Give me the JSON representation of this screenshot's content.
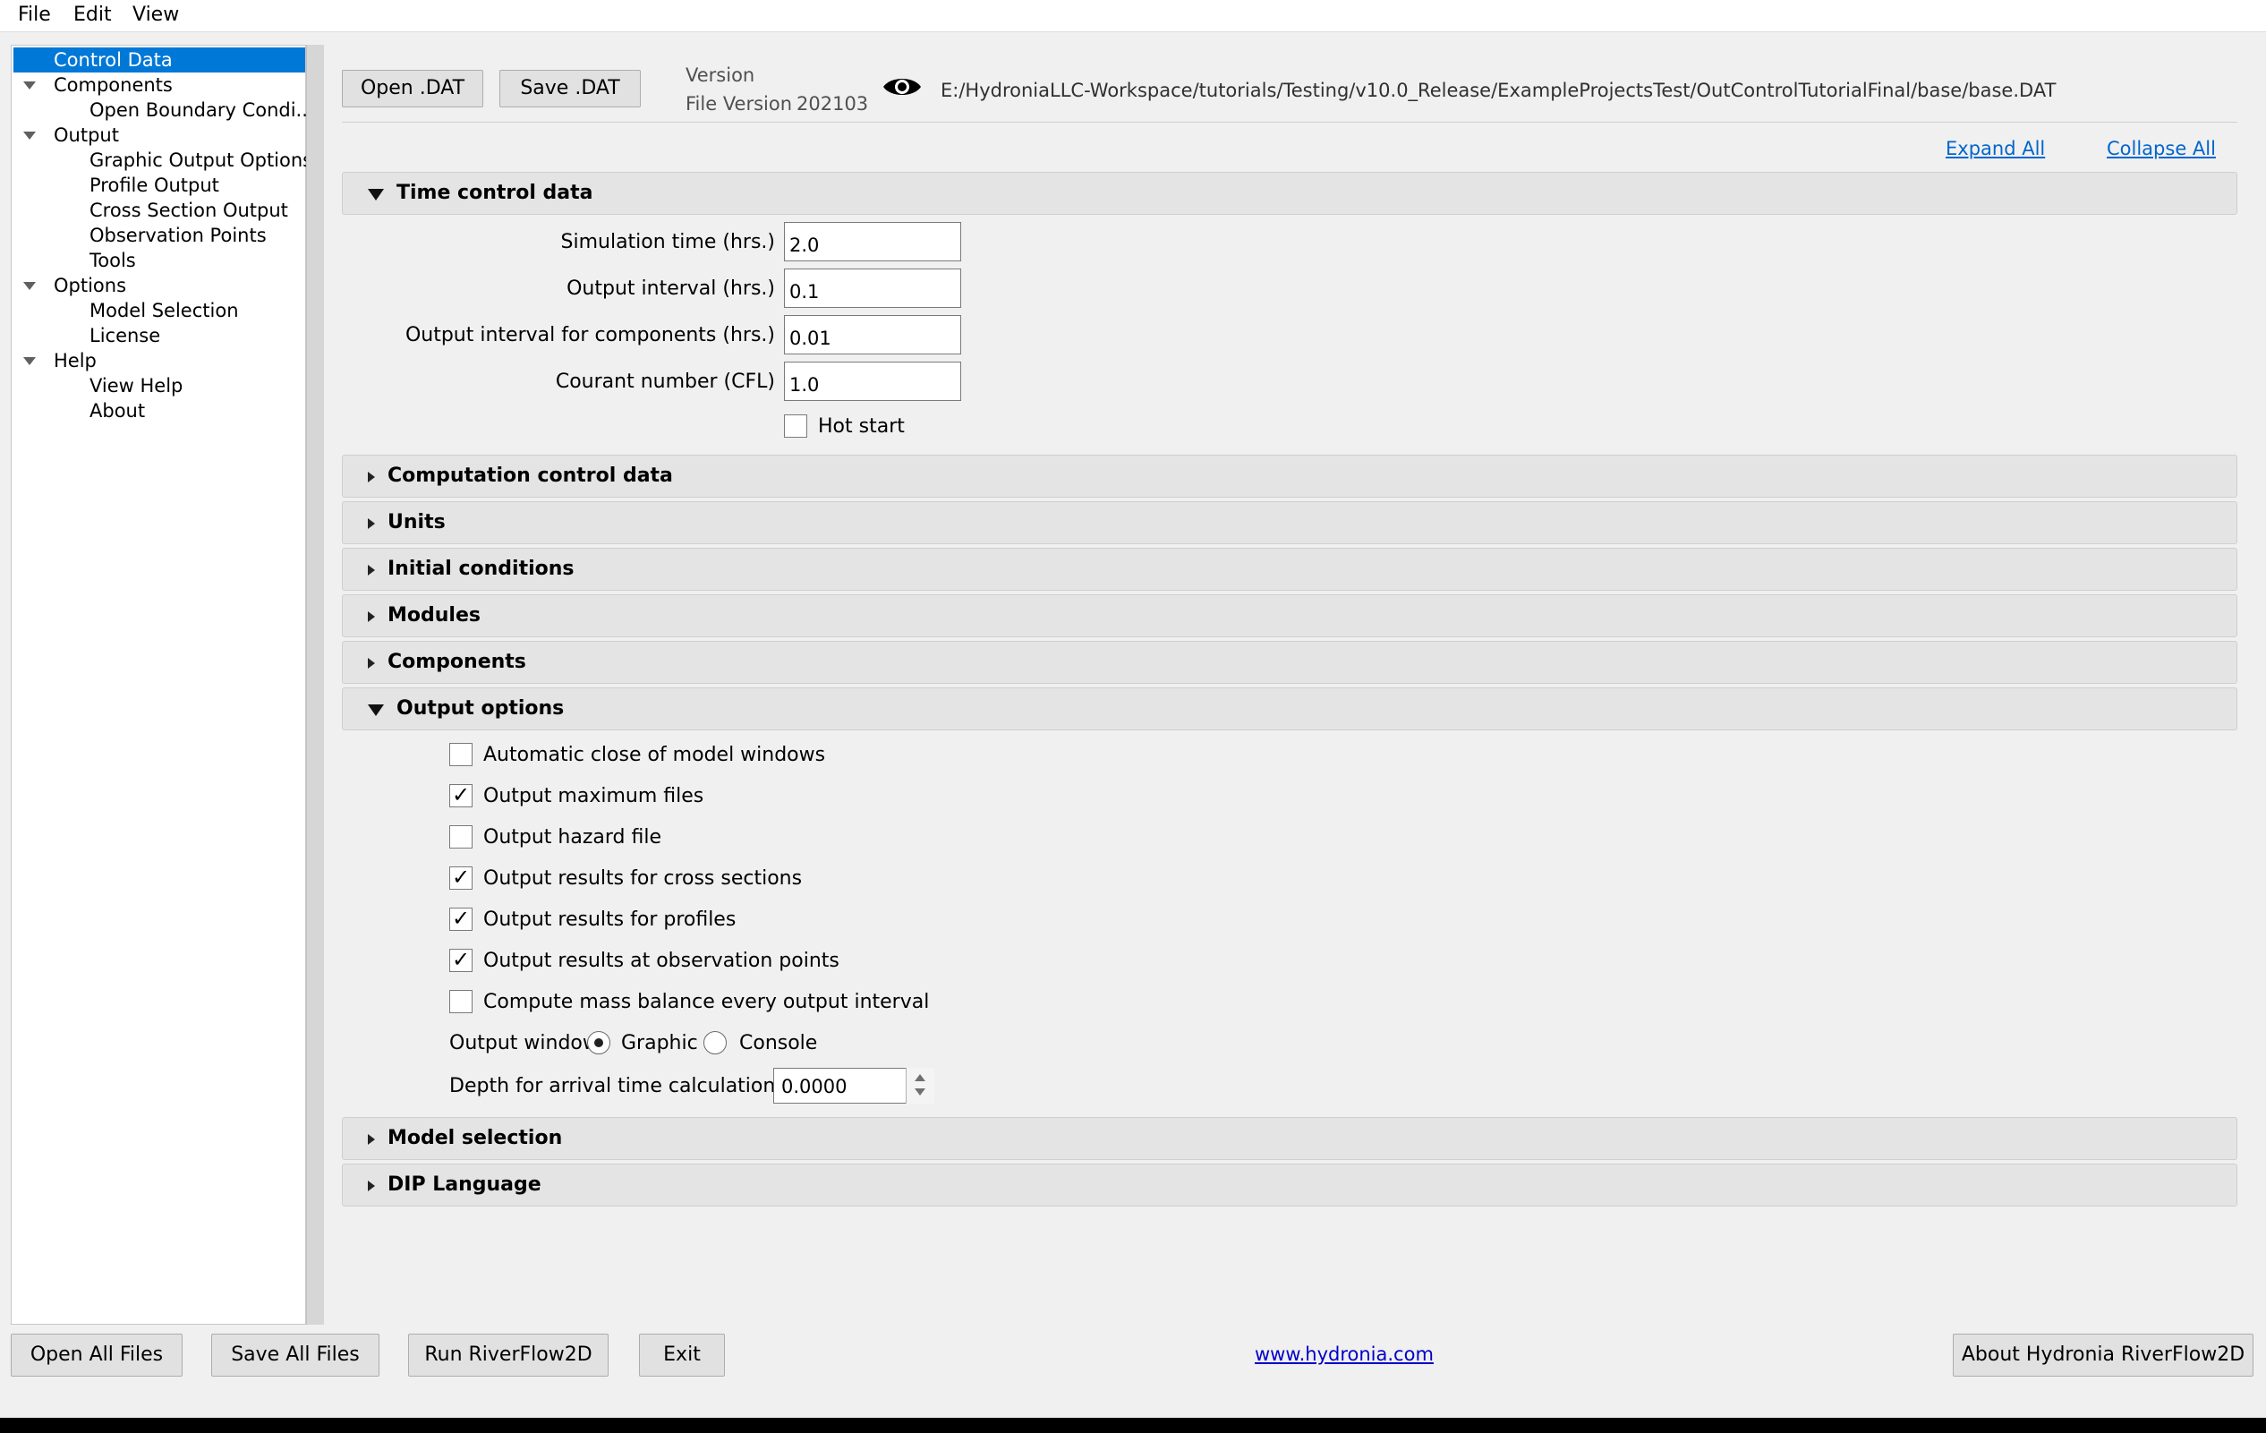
{
  "menubar": {
    "file": "File",
    "edit": "Edit",
    "view": "View"
  },
  "tree": {
    "items": [
      {
        "label": "Control Data"
      },
      {
        "label": "Components"
      },
      {
        "label": "Open Boundary Condi..."
      },
      {
        "label": "Output"
      },
      {
        "label": "Graphic Output Options"
      },
      {
        "label": "Profile Output"
      },
      {
        "label": "Cross Section Output"
      },
      {
        "label": "Observation Points"
      },
      {
        "label": "Tools"
      },
      {
        "label": "Options"
      },
      {
        "label": "Model Selection"
      },
      {
        "label": "License"
      },
      {
        "label": "Help"
      },
      {
        "label": "View Help"
      },
      {
        "label": "About"
      }
    ]
  },
  "toolbar": {
    "open_dat": "Open .DAT",
    "save_dat": "Save .DAT",
    "version_label": "Version",
    "file_version_label": "File Version",
    "file_version_value": "202103",
    "file_path": "E:/HydroniaLLC-Workspace/tutorials/Testing/v10.0_Release/ExampleProjectsTest/OutControlTutorialFinal/base/base.DAT",
    "eye_icon": "eye-icon"
  },
  "links": {
    "expand_all": "Expand All",
    "collapse_all": "Collapse All"
  },
  "sections": {
    "time_control": "Time control data",
    "computation_control": "Computation control data",
    "units": "Units",
    "initial_conditions": "Initial conditions",
    "modules": "Modules",
    "components": "Components",
    "output_options": "Output options",
    "model_selection": "Model selection",
    "dip_language": "DIP Language"
  },
  "time_control": {
    "sim_time_label": "Simulation time (hrs.)",
    "sim_time_value": "2.0",
    "output_interval_label": "Output interval (hrs.)",
    "output_interval_value": "0.1",
    "output_interval_comp_label": "Output interval for components (hrs.)",
    "output_interval_comp_value": "0.01",
    "courant_label": "Courant number (CFL)",
    "courant_value": "1.0",
    "hot_start_label": "Hot start",
    "hot_start_checked": false
  },
  "output_options": {
    "checkboxes": [
      {
        "label": "Automatic close of model windows",
        "checked": false,
        "mark": ""
      },
      {
        "label": "Output maximum files",
        "checked": true,
        "mark": "✓"
      },
      {
        "label": "Output hazard file",
        "checked": false,
        "mark": ""
      },
      {
        "label": "Output results for cross sections",
        "checked": true,
        "mark": "✓"
      },
      {
        "label": "Output results for profiles",
        "checked": true,
        "mark": "✓"
      },
      {
        "label": "Output results at observation points",
        "checked": true,
        "mark": "✓"
      },
      {
        "label": "Compute mass balance every output interval",
        "checked": false,
        "mark": ""
      }
    ],
    "output_window_label": "Output window",
    "graphic_label": "Graphic",
    "console_label": "Console",
    "selected_window": "Graphic",
    "depth_label": "Depth for arrival time calculation (ft)",
    "depth_value": "0.0000"
  },
  "footer": {
    "open_all": "Open All Files",
    "save_all": "Save All Files",
    "run": "Run RiverFlow2D",
    "exit": "Exit",
    "website": "www.hydronia.com",
    "about": "About Hydronia RiverFlow2D"
  },
  "colors": {
    "selection": "#0078d7",
    "link": "#0066cc",
    "section_bg": "#e4e4e4",
    "window_bg": "#f0f0f0"
  }
}
